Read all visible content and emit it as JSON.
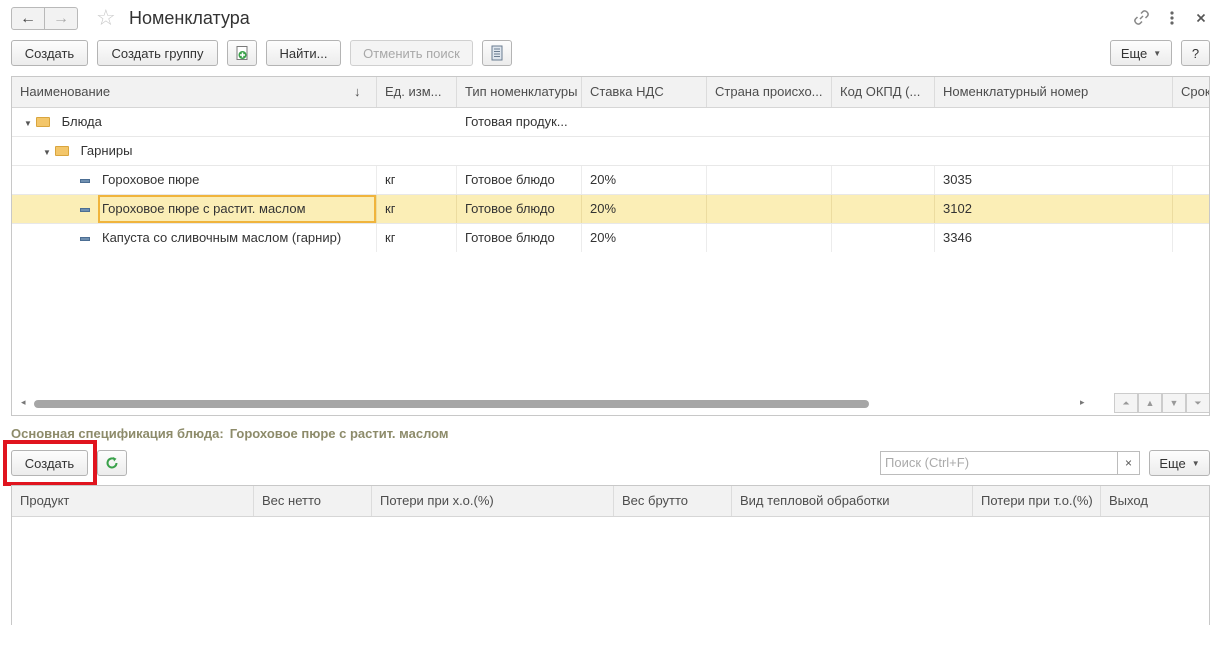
{
  "window": {
    "title": "Номенклатура",
    "nav_back": "←",
    "nav_forward": "→",
    "star": "☆",
    "link_icon": "link-icon",
    "menu_icon": "more-vertical-icon",
    "close_icon": "close-icon"
  },
  "toolbar": {
    "create_label": "Создать",
    "create_group_label": "Создать группу",
    "find_label": "Найти...",
    "cancel_search_label": "Отменить поиск",
    "more_label": "Еще",
    "help_label": "?"
  },
  "table": {
    "columns": [
      "Наименование",
      "Ед. изм...",
      "Тип номенклатуры",
      "Ставка НДС",
      "Страна происхо...",
      "Код ОКПД (...",
      "Номенклатурный номер",
      "Срок"
    ],
    "sort_indicator": "↓",
    "rows": [
      {
        "name": "Блюда",
        "unit": "",
        "type": "Готовая продук...",
        "vat": "",
        "country": "",
        "okpd": "",
        "number": ""
      },
      {
        "name": "Гарниры",
        "unit": "",
        "type": "",
        "vat": "",
        "country": "",
        "okpd": "",
        "number": ""
      },
      {
        "name": "Гороховое пюре",
        "unit": "кг",
        "type": "Готовое блюдо",
        "vat": "20%",
        "country": "",
        "okpd": "",
        "number": "3035"
      },
      {
        "name": "Гороховое пюре с растит. маслом",
        "unit": "кг",
        "type": "Готовое блюдо",
        "vat": "20%",
        "country": "",
        "okpd": "",
        "number": "3102"
      },
      {
        "name": "Капуста со сливочным маслом  (гарнир)",
        "unit": "кг",
        "type": "Готовое блюдо",
        "vat": "20%",
        "country": "",
        "okpd": "",
        "number": "3346"
      }
    ]
  },
  "spec": {
    "label": "Основная спецификация блюда:",
    "value": "Гороховое пюре с растит. маслом",
    "create_label": "Создать",
    "search_placeholder": "Поиск (Ctrl+F)",
    "search_clear": "×",
    "more_label": "Еще",
    "columns": [
      "Продукт",
      "Вес нетто",
      "Потери при х.о.(%)",
      "Вес брутто",
      "Вид тепловой обработки",
      "Потери при т.о.(%)",
      "Выход"
    ]
  },
  "colors": {
    "selection": "#fbeeb6",
    "highlight_box": "#e0141e",
    "spec_label": "#8d8b6a"
  }
}
